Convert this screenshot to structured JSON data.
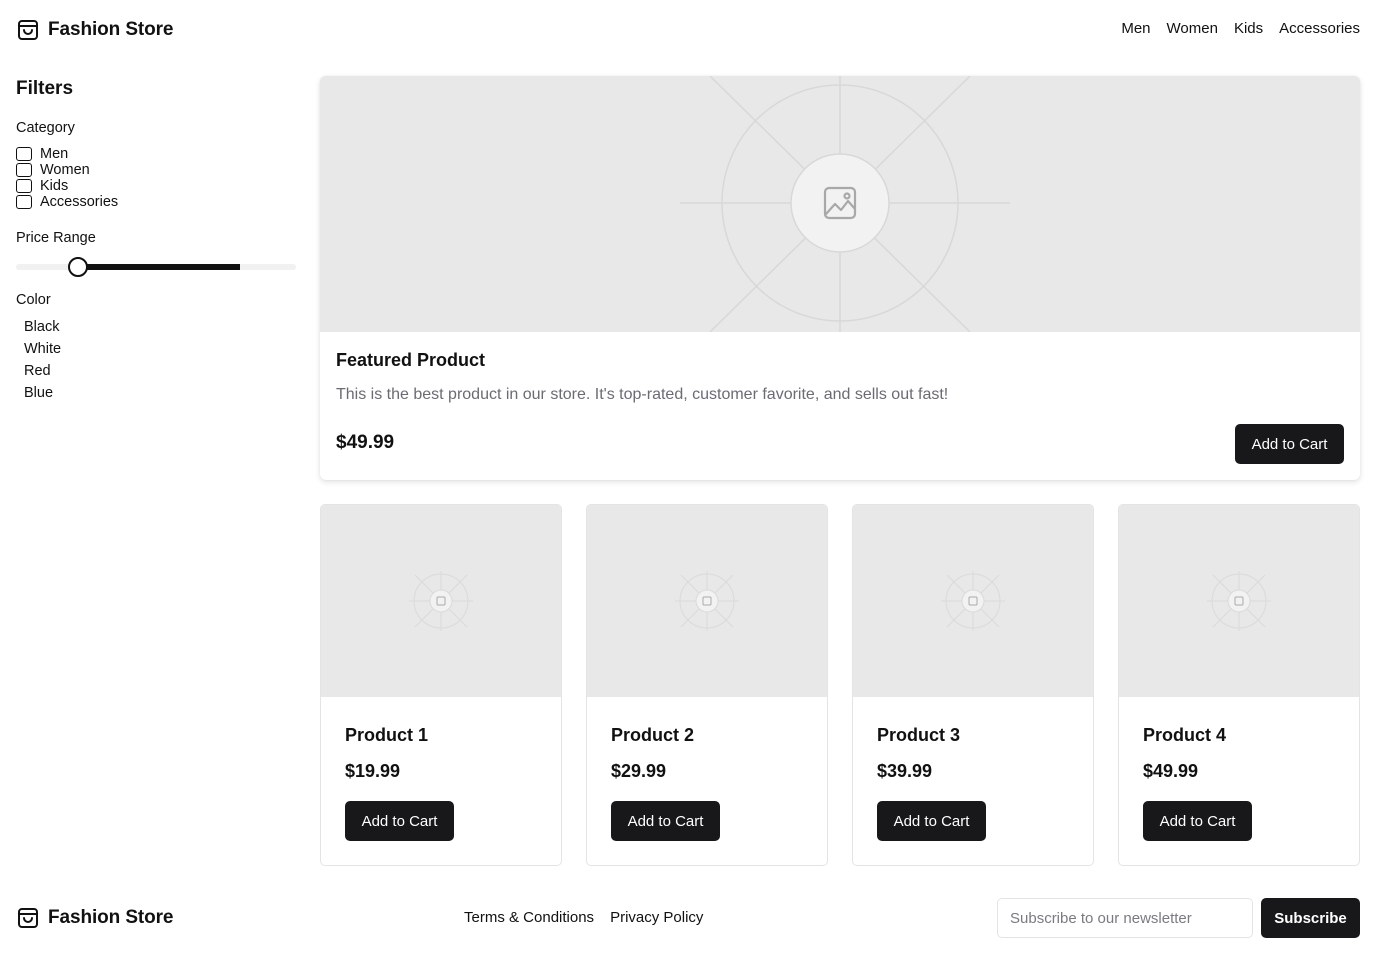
{
  "header": {
    "brand": "Fashion Store",
    "brand_icon": "shopping-bag-icon",
    "nav": [
      "Men",
      "Women",
      "Kids",
      "Accessories"
    ]
  },
  "filters": {
    "title": "Filters",
    "category_label": "Category",
    "categories": [
      "Men",
      "Women",
      "Kids",
      "Accessories"
    ],
    "price_label": "Price Range",
    "price_range_fraction": [
      0.22,
      0.8
    ],
    "color_label": "Color",
    "colors": [
      "Black",
      "White",
      "Red",
      "Blue"
    ]
  },
  "featured": {
    "title": "Featured Product",
    "description": "This is the best product in our store. It's top-rated, customer favorite, and sells out fast!",
    "price": "$49.99",
    "button": "Add to Cart",
    "image_icon": "image-placeholder-icon"
  },
  "products": [
    {
      "name": "Product 1",
      "price": "$19.99",
      "button": "Add to Cart"
    },
    {
      "name": "Product 2",
      "price": "$29.99",
      "button": "Add to Cart"
    },
    {
      "name": "Product 3",
      "price": "$39.99",
      "button": "Add to Cart"
    },
    {
      "name": "Product 4",
      "price": "$49.99",
      "button": "Add to Cart"
    }
  ],
  "footer": {
    "brand": "Fashion Store",
    "links": [
      "Terms & Conditions",
      "Privacy Policy"
    ],
    "newsletter_placeholder": "Subscribe to our newsletter",
    "subscribe_button": "Subscribe"
  },
  "colors": {
    "primary": "#18181b",
    "placeholder_bg": "#e8e8e8",
    "muted_text": "#6b6b73",
    "border": "#e4e4e7"
  }
}
